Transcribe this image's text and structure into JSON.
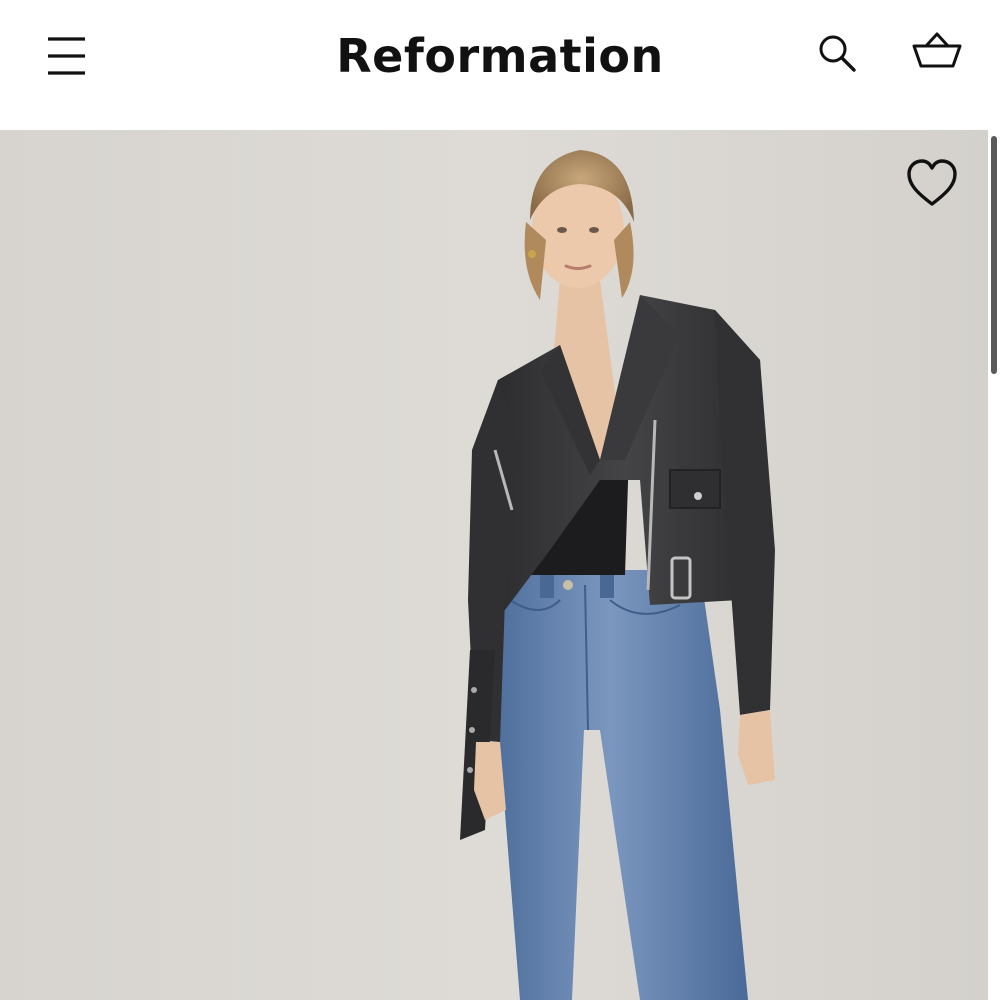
{
  "header": {
    "brand": "Reformation",
    "menu_icon": "hamburger-menu-icon",
    "search_icon": "search-icon",
    "bag_icon": "shopping-basket-icon"
  },
  "product": {
    "wishlist_icon": "heart-outline-icon",
    "image_description_icon": "product-photo"
  },
  "colors": {
    "header_bg": "#ffffff",
    "brand_text": "#111111",
    "photo_bg": "#d9d6d1",
    "scrollbar_thumb": "#5a5a5a"
  }
}
